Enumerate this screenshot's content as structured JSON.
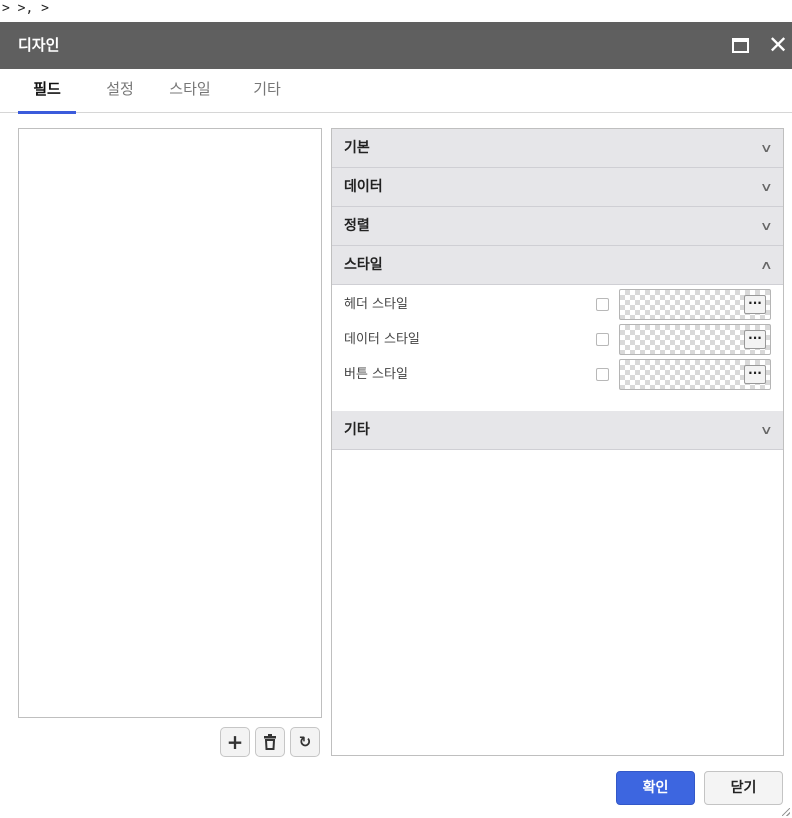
{
  "breadcrumb": "> >, >",
  "dialog": {
    "title": "디자인"
  },
  "tabs": [
    {
      "label": "필드",
      "active": true
    },
    {
      "label": "설정",
      "active": false
    },
    {
      "label": "스타일",
      "active": false
    },
    {
      "label": "기타",
      "active": false
    }
  ],
  "left_toolbar": {
    "add_icon": "plus-icon",
    "delete_icon": "trash-icon",
    "refresh_icon": "refresh-icon"
  },
  "sections": [
    {
      "label": "기본",
      "expanded": false
    },
    {
      "label": "데이터",
      "expanded": false
    },
    {
      "label": "정렬",
      "expanded": false
    },
    {
      "label": "스타일",
      "expanded": true
    },
    {
      "label": "기타",
      "expanded": false
    }
  ],
  "style_rows": [
    {
      "label": "헤더 스타일",
      "checked": false
    },
    {
      "label": "데이터 스타일",
      "checked": false
    },
    {
      "label": "버튼 스타일",
      "checked": false
    }
  ],
  "footer": {
    "confirm_label": "확인",
    "close_label": "닫기"
  },
  "colors": {
    "titlebar": "#5f5f5f",
    "accent": "#3d66e0",
    "tab_indicator": "#3b5bdb",
    "section_header": "#e6e6e9"
  }
}
